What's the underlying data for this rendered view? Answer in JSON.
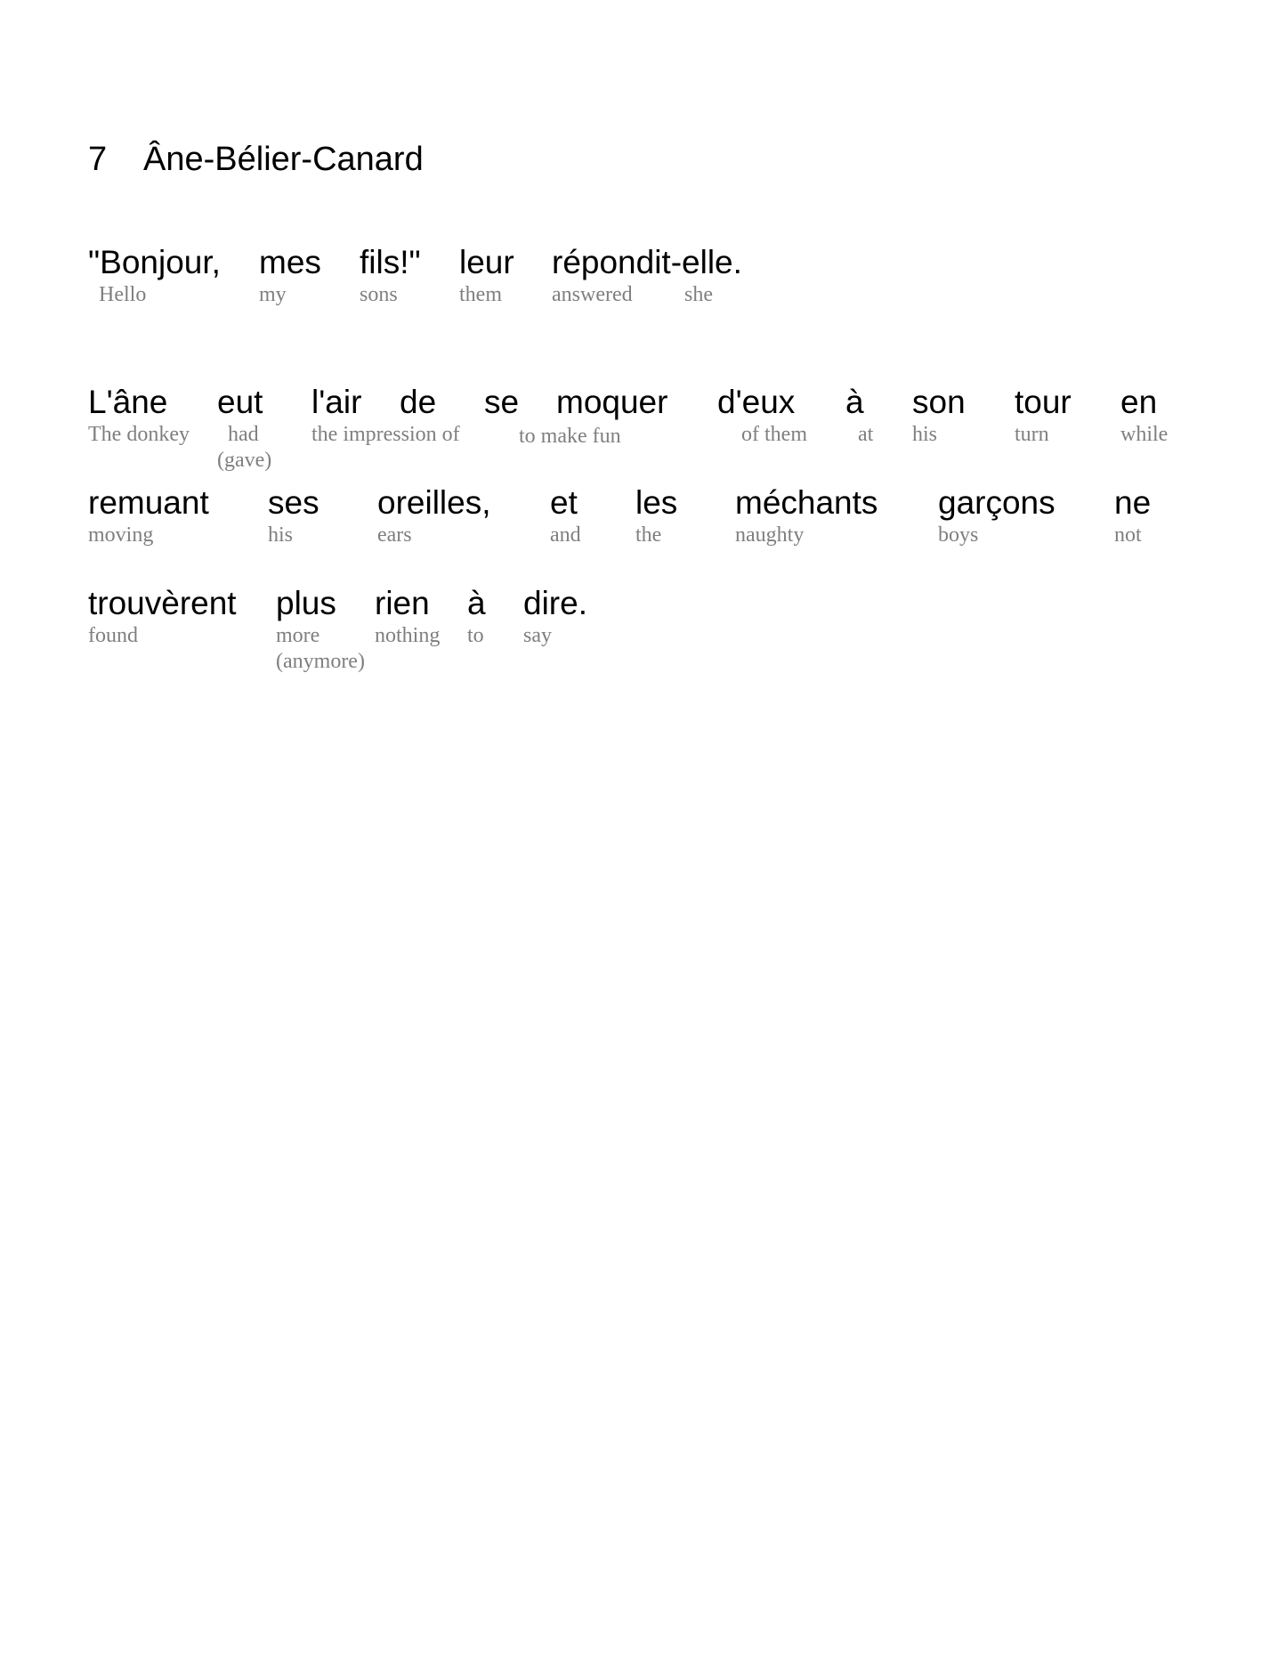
{
  "heading": {
    "number": "7",
    "title": "Âne-Bélier-Canard"
  },
  "lines": [
    {
      "tokens": [
        {
          "fr": "\"Bonjour,",
          "en": "Hello",
          "en2": ""
        },
        {
          "fr": "mes",
          "en": "my",
          "en2": ""
        },
        {
          "fr": "fils!\"",
          "en": "sons",
          "en2": ""
        },
        {
          "fr": "leur",
          "en": "them",
          "en2": ""
        },
        {
          "fr": "répondit-elle.",
          "en": "answered",
          "en2": ""
        },
        {
          "fr": "",
          "en": "she",
          "en2": ""
        }
      ]
    },
    {
      "tokens": [
        {
          "fr": "L'âne",
          "en": "The donkey",
          "en2": ""
        },
        {
          "fr": "eut",
          "en": "had",
          "en2": "(gave)"
        },
        {
          "fr": "l'air",
          "en": "the impression of",
          "en2": ""
        },
        {
          "fr": "de",
          "en": "",
          "en2": ""
        },
        {
          "fr": "se",
          "en": "to make fun",
          "en2": ""
        },
        {
          "fr": "moquer",
          "en": "",
          "en2": ""
        },
        {
          "fr": "d'eux",
          "en": "of them",
          "en2": ""
        },
        {
          "fr": "à",
          "en": "at",
          "en2": ""
        },
        {
          "fr": "son",
          "en": "his",
          "en2": ""
        },
        {
          "fr": "tour",
          "en": "turn",
          "en2": ""
        },
        {
          "fr": "en",
          "en": "while",
          "en2": ""
        }
      ]
    },
    {
      "tokens": [
        {
          "fr": "remuant",
          "en": "moving",
          "en2": ""
        },
        {
          "fr": "ses",
          "en": "his",
          "en2": ""
        },
        {
          "fr": "oreilles,",
          "en": "ears",
          "en2": ""
        },
        {
          "fr": "et",
          "en": "and",
          "en2": ""
        },
        {
          "fr": "les",
          "en": "the",
          "en2": ""
        },
        {
          "fr": "méchants",
          "en": "naughty",
          "en2": ""
        },
        {
          "fr": "garçons",
          "en": "boys",
          "en2": ""
        },
        {
          "fr": "ne",
          "en": "not",
          "en2": ""
        }
      ]
    },
    {
      "tokens": [
        {
          "fr": "trouvèrent",
          "en": "found",
          "en2": ""
        },
        {
          "fr": "plus",
          "en": "more",
          "en2": "(anymore)"
        },
        {
          "fr": "rien",
          "en": "nothing",
          "en2": ""
        },
        {
          "fr": "à",
          "en": "to",
          "en2": ""
        },
        {
          "fr": "dire.",
          "en": "say",
          "en2": ""
        }
      ]
    }
  ]
}
